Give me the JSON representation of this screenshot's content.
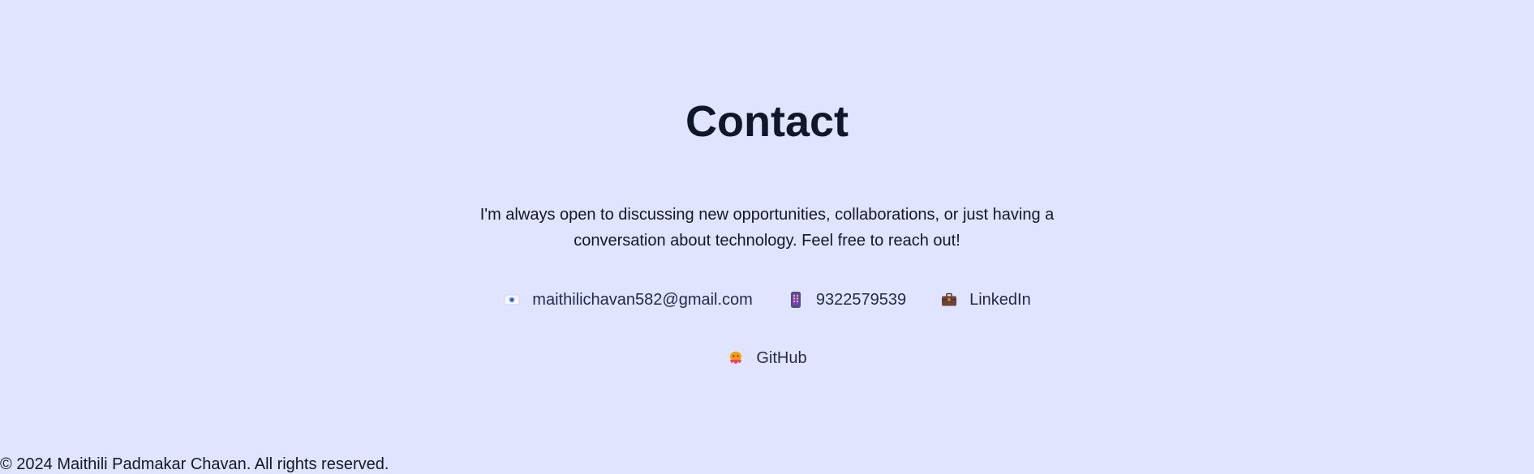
{
  "contact": {
    "title": "Contact",
    "intro_line1": "I'm always open to discussing new opportunities, collaborations, or just having a",
    "intro_line2": "conversation about technology. Feel free to reach out!",
    "links": [
      {
        "label": "maithilichavan582@gmail.com",
        "icon": "email-icon"
      },
      {
        "label": "9322579539",
        "icon": "phone-icon"
      },
      {
        "label": "LinkedIn",
        "icon": "briefcase-icon"
      },
      {
        "label": "GitHub",
        "icon": "octopus-icon"
      }
    ]
  },
  "footer": {
    "copyright": "© 2024 Maithili Padmakar Chavan. All rights reserved."
  },
  "colors": {
    "background": "#e0e4ff",
    "heading": "#0f172a",
    "link": "#1f2a4d"
  }
}
